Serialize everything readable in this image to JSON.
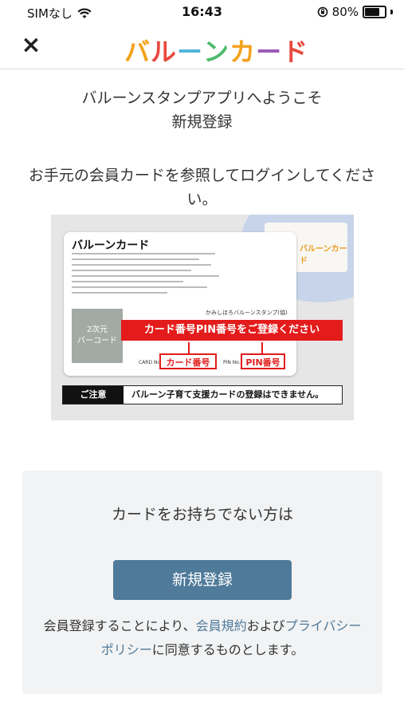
{
  "status_bar": {
    "carrier": "SIMなし",
    "time": "16:43",
    "battery": "80%",
    "battery_level": 0.8
  },
  "header": {
    "close_label": "×",
    "logo_chars": [
      "バ",
      "ル",
      "ー",
      "ン",
      "カ",
      "ー",
      "ド"
    ],
    "logo_colors": [
      "#f4a21d",
      "#e8493c",
      "#52b3d9",
      "#4dba6a",
      "#f4a21d",
      "#9b59b6",
      "#e8493c"
    ]
  },
  "welcome": {
    "line1": "バルーンスタンプアプリへようこそ",
    "line2": "新規登録"
  },
  "instruction": "お手元の会員カードを参照してログインしてください。",
  "card_image": {
    "title": "バルーンカード",
    "mini_logo": "バルーンカード",
    "barcode_label_1": "2次元",
    "barcode_label_2": "バーコード",
    "company": "かみしほろバルーンスタンプ(協)",
    "banner": "カード番号PIN番号をご登録ください",
    "card_no_label": "CARD No.",
    "pin_no_label": "PIN No.",
    "card_number_box": "カード番号",
    "pin_number_box": "PIN番号",
    "notice_label": "ご注意",
    "notice_text": "バルーン子育て支援カードの登録はできません。"
  },
  "signup": {
    "prompt": "カードをお持ちでない方は",
    "button": "新規登録",
    "terms_prefix": "会員登録することにより、",
    "terms_link": "会員規約",
    "terms_middle": "および",
    "privacy_link": "プライバシーポリシー",
    "terms_suffix": "に同意するものとします。"
  },
  "colors": {
    "accent": "#4f7a9a",
    "red": "#e31b1b"
  }
}
